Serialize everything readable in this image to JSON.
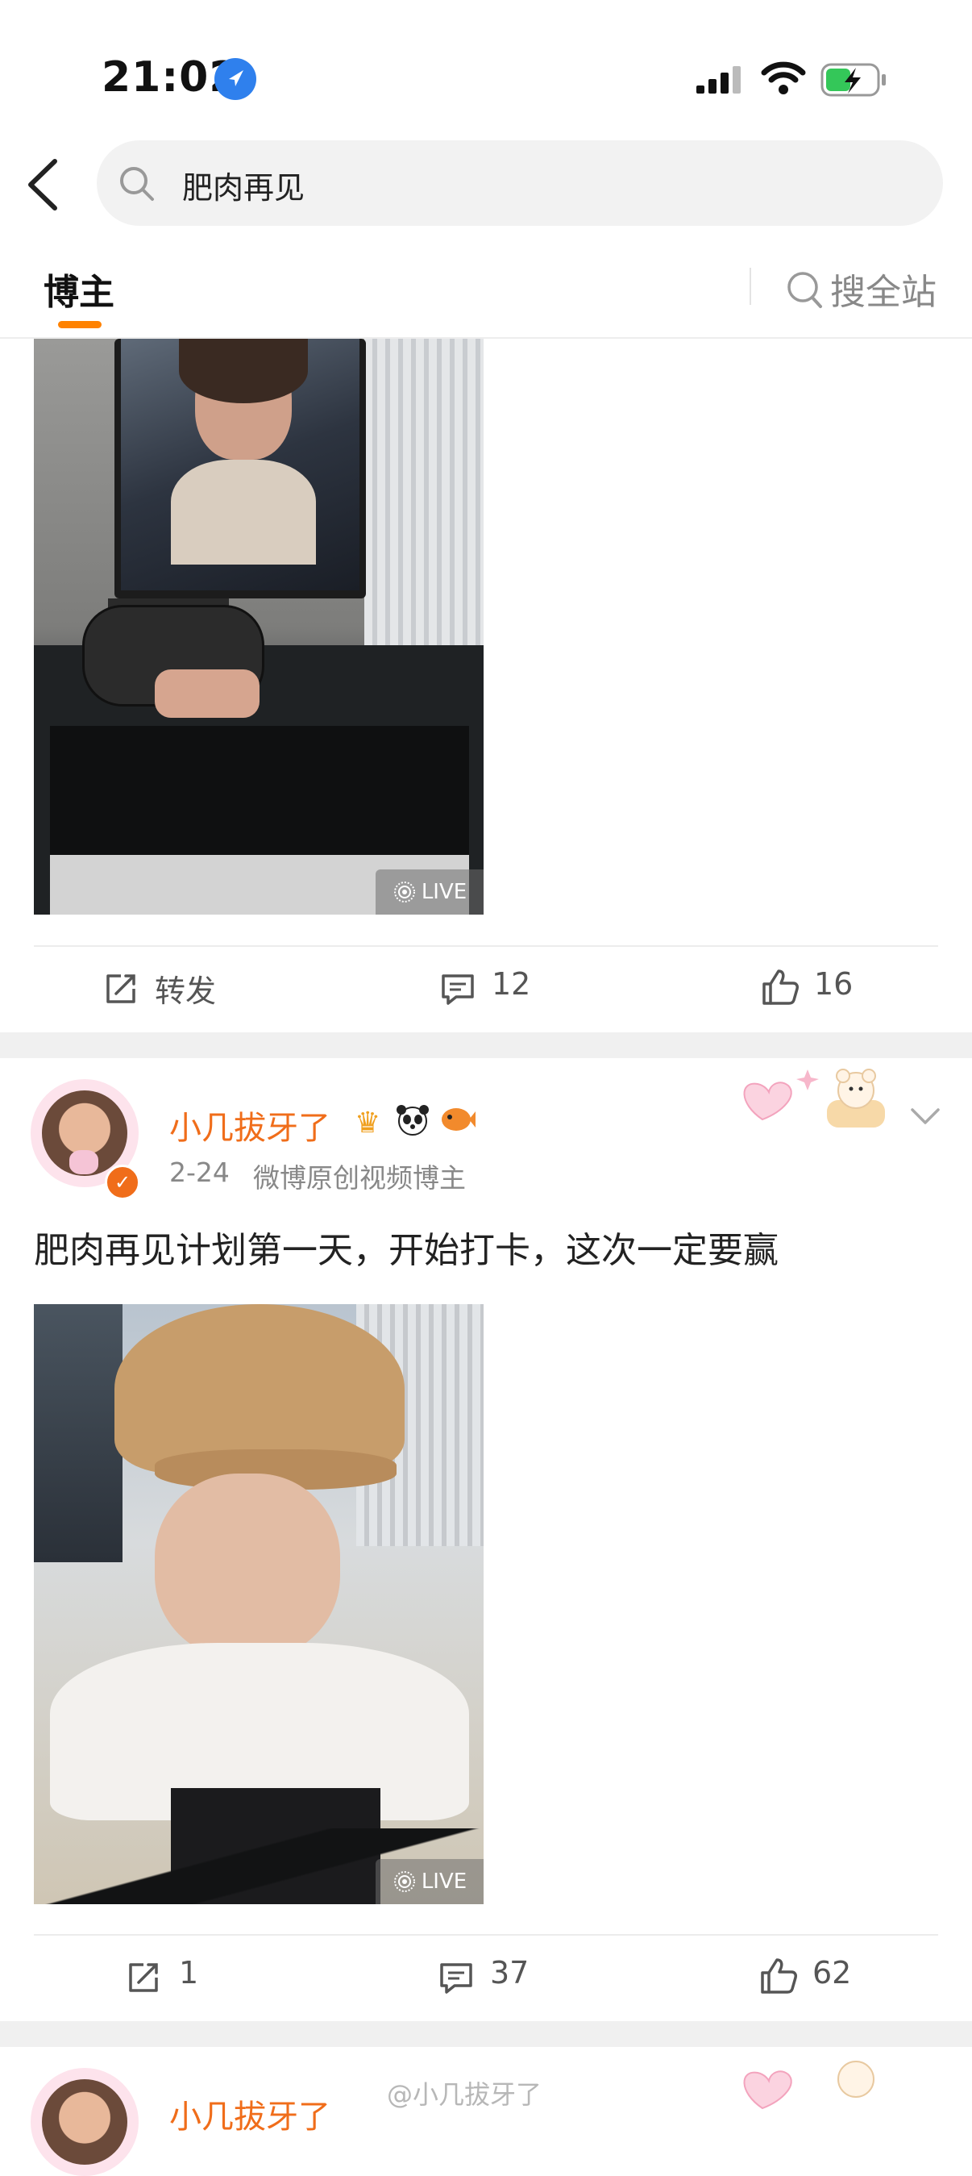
{
  "status_bar": {
    "time": "21:02"
  },
  "search": {
    "query": "肥肉再见"
  },
  "tabs": {
    "active": "博主",
    "search_all": "搜全站"
  },
  "post1": {
    "live_badge": "LIVE",
    "actions": {
      "repost": "转发",
      "comments": "12",
      "likes": "16"
    }
  },
  "post2": {
    "username": "小几拔牙了",
    "date": "2-24",
    "source": "微博原创视频博主",
    "text": "肥肉再见计划第一天，开始打卡，这次一定要赢",
    "live_badge": "LIVE",
    "actions": {
      "repost": "1",
      "comments": "37",
      "likes": "62"
    }
  },
  "post3": {
    "username": "小几拔牙了"
  },
  "watermark": "@小几拔牙了",
  "colors": {
    "accent": "#ff8200",
    "username": "#f06d1a",
    "verified": "#f06d1a"
  }
}
